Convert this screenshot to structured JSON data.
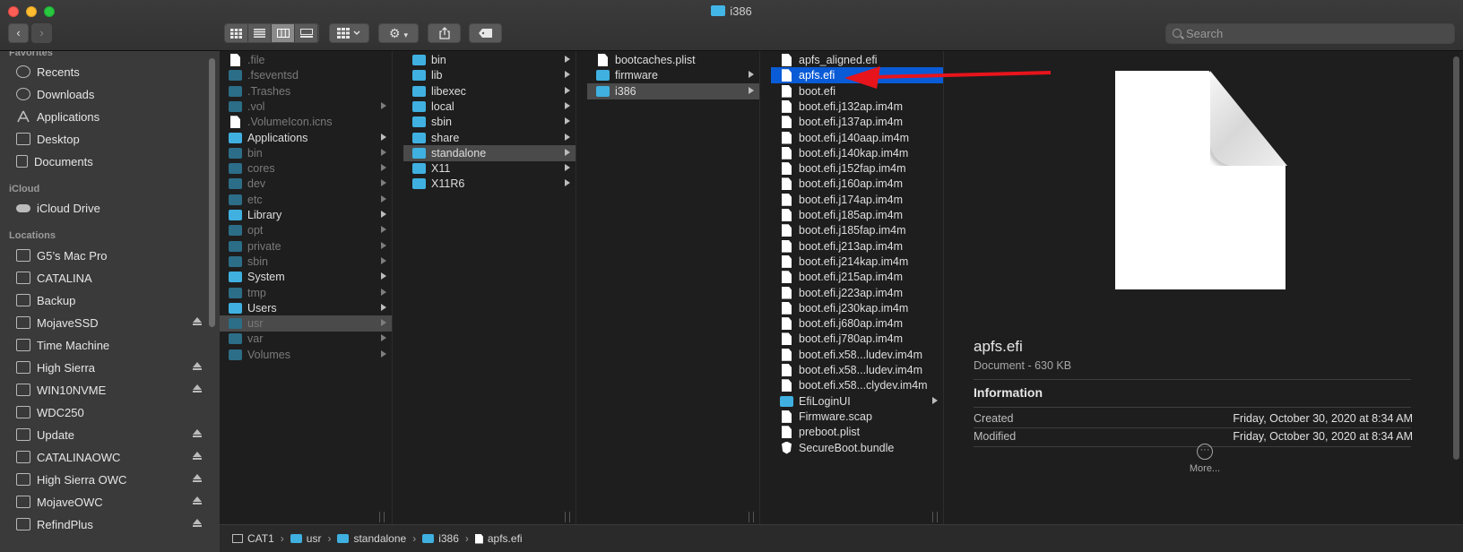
{
  "window": {
    "title": "i386"
  },
  "toolbar": {
    "search_placeholder": "Search"
  },
  "sidebar": {
    "favorites_header": "Favorites",
    "favorites": [
      {
        "label": "Recents",
        "icon": "clock-icon"
      },
      {
        "label": "Downloads",
        "icon": "download-icon"
      },
      {
        "label": "Applications",
        "icon": "applications-icon"
      },
      {
        "label": "Desktop",
        "icon": "desktop-icon"
      },
      {
        "label": "Documents",
        "icon": "document-icon"
      }
    ],
    "icloud_header": "iCloud",
    "icloud": [
      {
        "label": "iCloud Drive",
        "icon": "cloud-icon"
      }
    ],
    "locations_header": "Locations",
    "locations": [
      {
        "label": "G5’s Mac Pro",
        "eject": false
      },
      {
        "label": "CATALINA",
        "eject": false
      },
      {
        "label": "Backup",
        "eject": false
      },
      {
        "label": "MojaveSSD",
        "eject": true
      },
      {
        "label": "Time Machine",
        "eject": false
      },
      {
        "label": "High Sierra",
        "eject": true
      },
      {
        "label": "WIN10NVME",
        "eject": true
      },
      {
        "label": "WDC250",
        "eject": false
      },
      {
        "label": "Update",
        "eject": true
      },
      {
        "label": "CATALINAOWC",
        "eject": true
      },
      {
        "label": "High Sierra OWC",
        "eject": true
      },
      {
        "label": "MojaveOWC",
        "eject": true
      },
      {
        "label": "RefindPlus",
        "eject": true
      }
    ]
  },
  "columns": {
    "root": [
      {
        "label": ".file",
        "dim": true,
        "kind": "doc"
      },
      {
        "label": ".fseventsd",
        "dim": true,
        "kind": "folder"
      },
      {
        "label": ".Trashes",
        "dim": true,
        "kind": "folder"
      },
      {
        "label": ".vol",
        "dim": true,
        "kind": "folder",
        "arrow": true
      },
      {
        "label": ".VolumeIcon.icns",
        "dim": true,
        "kind": "doc"
      },
      {
        "label": "Applications",
        "dim": false,
        "kind": "folder",
        "arrow": true
      },
      {
        "label": "bin",
        "dim": true,
        "kind": "folder",
        "arrow": true
      },
      {
        "label": "cores",
        "dim": true,
        "kind": "folder",
        "arrow": true
      },
      {
        "label": "dev",
        "dim": true,
        "kind": "folder",
        "arrow": true
      },
      {
        "label": "etc",
        "dim": true,
        "kind": "folder",
        "arrow": true
      },
      {
        "label": "Library",
        "dim": false,
        "kind": "folder",
        "arrow": true
      },
      {
        "label": "opt",
        "dim": true,
        "kind": "folder",
        "arrow": true
      },
      {
        "label": "private",
        "dim": true,
        "kind": "folder",
        "arrow": true
      },
      {
        "label": "sbin",
        "dim": true,
        "kind": "folder",
        "arrow": true
      },
      {
        "label": "System",
        "dim": false,
        "kind": "folder",
        "arrow": true
      },
      {
        "label": "tmp",
        "dim": true,
        "kind": "folder",
        "arrow": true
      },
      {
        "label": "Users",
        "dim": false,
        "kind": "folder",
        "arrow": true
      },
      {
        "label": "usr",
        "dim": true,
        "kind": "folder",
        "arrow": true,
        "selected": "gray"
      },
      {
        "label": "var",
        "dim": true,
        "kind": "folder",
        "arrow": true
      },
      {
        "label": "Volumes",
        "dim": true,
        "kind": "folder",
        "arrow": true
      }
    ],
    "usr": [
      {
        "label": "bin",
        "kind": "folder",
        "arrow": true
      },
      {
        "label": "lib",
        "kind": "folder",
        "arrow": true
      },
      {
        "label": "libexec",
        "kind": "folder",
        "arrow": true
      },
      {
        "label": "local",
        "kind": "folder",
        "arrow": true
      },
      {
        "label": "sbin",
        "kind": "folder",
        "arrow": true
      },
      {
        "label": "share",
        "kind": "folder",
        "arrow": true
      },
      {
        "label": "standalone",
        "kind": "folder",
        "arrow": true,
        "selected": "gray"
      },
      {
        "label": "X11",
        "kind": "folder",
        "arrow": true
      },
      {
        "label": "X11R6",
        "kind": "folder",
        "arrow": true
      }
    ],
    "standalone": [
      {
        "label": "bootcaches.plist",
        "kind": "doc"
      },
      {
        "label": "firmware",
        "kind": "folder",
        "arrow": true
      },
      {
        "label": "i386",
        "kind": "folder",
        "arrow": true,
        "selected": "gray"
      }
    ],
    "i386": [
      {
        "label": "apfs_aligned.efi",
        "kind": "doc"
      },
      {
        "label": "apfs.efi",
        "kind": "doc",
        "selected": "blue"
      },
      {
        "label": "boot.efi",
        "kind": "doc"
      },
      {
        "label": "boot.efi.j132ap.im4m",
        "kind": "doc"
      },
      {
        "label": "boot.efi.j137ap.im4m",
        "kind": "doc"
      },
      {
        "label": "boot.efi.j140aap.im4m",
        "kind": "doc"
      },
      {
        "label": "boot.efi.j140kap.im4m",
        "kind": "doc"
      },
      {
        "label": "boot.efi.j152fap.im4m",
        "kind": "doc"
      },
      {
        "label": "boot.efi.j160ap.im4m",
        "kind": "doc"
      },
      {
        "label": "boot.efi.j174ap.im4m",
        "kind": "doc"
      },
      {
        "label": "boot.efi.j185ap.im4m",
        "kind": "doc"
      },
      {
        "label": "boot.efi.j185fap.im4m",
        "kind": "doc"
      },
      {
        "label": "boot.efi.j213ap.im4m",
        "kind": "doc"
      },
      {
        "label": "boot.efi.j214kap.im4m",
        "kind": "doc"
      },
      {
        "label": "boot.efi.j215ap.im4m",
        "kind": "doc"
      },
      {
        "label": "boot.efi.j223ap.im4m",
        "kind": "doc"
      },
      {
        "label": "boot.efi.j230kap.im4m",
        "kind": "doc"
      },
      {
        "label": "boot.efi.j680ap.im4m",
        "kind": "doc"
      },
      {
        "label": "boot.efi.j780ap.im4m",
        "kind": "doc"
      },
      {
        "label": "boot.efi.x58...ludev.im4m",
        "kind": "doc"
      },
      {
        "label": "boot.efi.x58...ludev.im4m",
        "kind": "doc"
      },
      {
        "label": "boot.efi.x58...clydev.im4m",
        "kind": "doc"
      },
      {
        "label": "EfiLoginUI",
        "kind": "folder",
        "arrow": true
      },
      {
        "label": "Firmware.scap",
        "kind": "doc"
      },
      {
        "label": "preboot.plist",
        "kind": "doc"
      },
      {
        "label": "SecureBoot.bundle",
        "kind": "bundle"
      }
    ]
  },
  "preview": {
    "name": "apfs.efi",
    "kind": "Document - 630 KB",
    "info_header": "Information",
    "created_label": "Created",
    "created_value": "Friday, October 30, 2020 at 8:34 AM",
    "modified_label": "Modified",
    "modified_value": "Friday, October 30, 2020 at 8:34 AM",
    "more_label": "More..."
  },
  "pathbar": [
    "CAT1",
    "usr",
    "standalone",
    "i386",
    "apfs.efi"
  ],
  "colors": {
    "accent": "#0a5bd6",
    "annotation_arrow": "#e8141c",
    "folder": "#3fb0e0"
  }
}
